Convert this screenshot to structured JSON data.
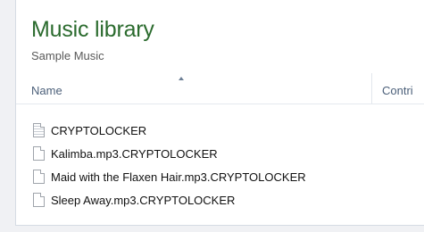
{
  "library": {
    "title": "Music library",
    "subtitle": "Sample Music"
  },
  "columns": {
    "name": "Name",
    "contributing": "Contri"
  },
  "files": [
    {
      "name": "CRYPTOLOCKER",
      "icon": "text-file-icon"
    },
    {
      "name": "Kalimba.mp3.CRYPTOLOCKER",
      "icon": "file-icon"
    },
    {
      "name": "Maid with the Flaxen Hair.mp3.CRYPTOLOCKER",
      "icon": "file-icon"
    },
    {
      "name": "Sleep Away.mp3.CRYPTOLOCKER",
      "icon": "file-icon"
    }
  ]
}
